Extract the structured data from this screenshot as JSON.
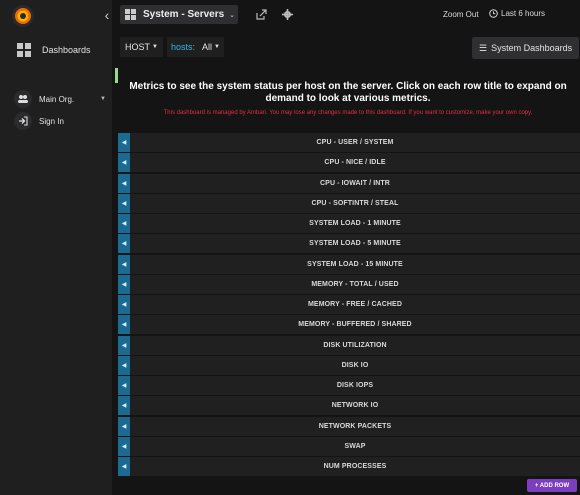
{
  "sidebar": {
    "logo": "grafana-logo",
    "dashboards_label": "Dashboards",
    "org_label": "Main Org.",
    "signin_label": "Sign In"
  },
  "navbar": {
    "dashboard_title": "System - Servers",
    "zoom_out_label": "Zoom Out",
    "time_range_label": "Last 6 hours"
  },
  "submenu": {
    "host_label": "HOST",
    "hosts_var_name": "hosts:",
    "hosts_var_value": "All",
    "system_dashboards_label": "System Dashboards"
  },
  "text_panel": {
    "heading": "Metrics to see the system status per host on the server. Click on each row title to expand on demand to look at various metrics.",
    "warning": "This dashboard is managed by Ambari. You may lose any changes made to this dashboard. If you want to customize, make your own copy."
  },
  "rows": [
    {
      "title": "CPU - USER / SYSTEM"
    },
    {
      "title": "CPU - NICE / IDLE"
    },
    {
      "title": "CPU - IOWAIT / INTR"
    },
    {
      "title": "CPU - SOFTINTR / STEAL"
    },
    {
      "title": "SYSTEM LOAD - 1 MINUTE"
    },
    {
      "title": "SYSTEM LOAD - 5 MINUTE"
    },
    {
      "title": "SYSTEM LOAD - 15 MINUTE"
    },
    {
      "title": "MEMORY - TOTAL / USED"
    },
    {
      "title": "MEMORY - FREE / CACHED"
    },
    {
      "title": "MEMORY - BUFFERED / SHARED"
    },
    {
      "title": "DISK UTILIZATION"
    },
    {
      "title": "DISK IO"
    },
    {
      "title": "DISK IOPS"
    },
    {
      "title": "NETWORK IO"
    },
    {
      "title": "NETWORK PACKETS"
    },
    {
      "title": "SWAP"
    },
    {
      "title": "NUM PROCESSES"
    }
  ],
  "add_row_label": "+ ADD ROW",
  "colors": {
    "accent_blue": "#33b5e5",
    "row_toggle": "#1a6a92",
    "warning_red": "#e02f44",
    "add_row_purple": "#7b3ebf"
  }
}
